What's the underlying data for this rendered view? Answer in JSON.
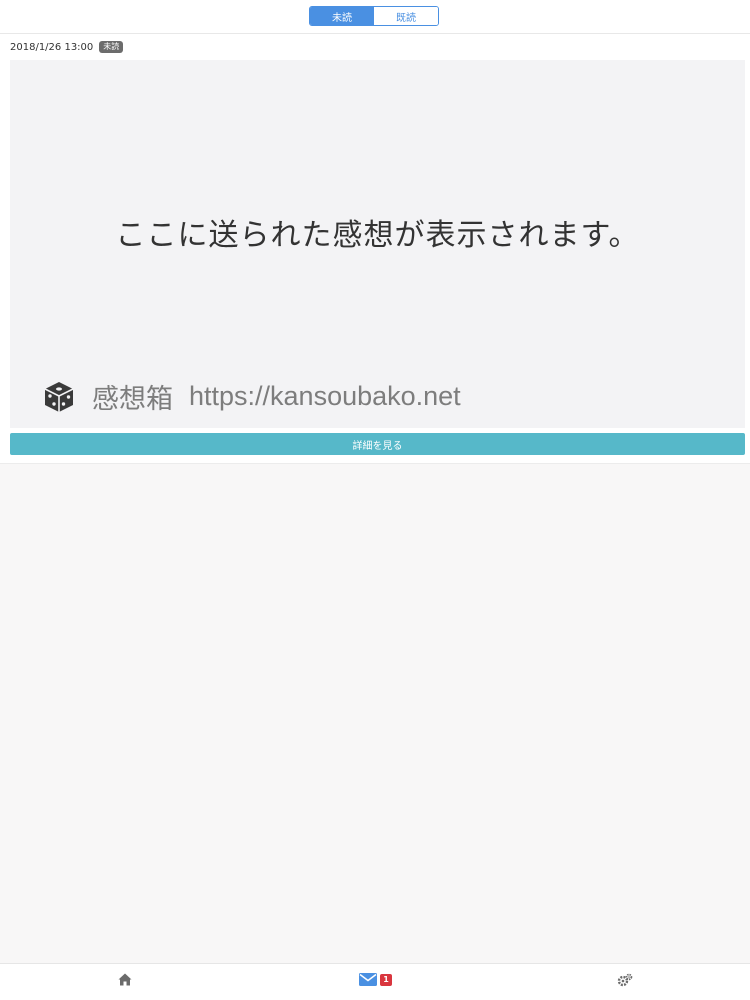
{
  "tabs": {
    "unread_label": "未読",
    "read_label": "既読",
    "active": "unread"
  },
  "message": {
    "timestamp": "2018/1/26 13:00",
    "status_badge": "未読",
    "preview_text": "ここに送られた感想が表示されます。",
    "brand_name": "感想箱",
    "brand_url": "https://kansoubako.net",
    "detail_button_label": "詳細を見る"
  },
  "bottom_nav": {
    "home_icon": "home-icon",
    "mail_icon": "envelope-icon",
    "mail_count": "1",
    "settings_icon": "gears-icon"
  },
  "colors": {
    "accent": "#4a90e2",
    "detail_button": "#56b8c9",
    "badge_red": "#d9363e",
    "badge_gray": "#6c6c6c"
  }
}
